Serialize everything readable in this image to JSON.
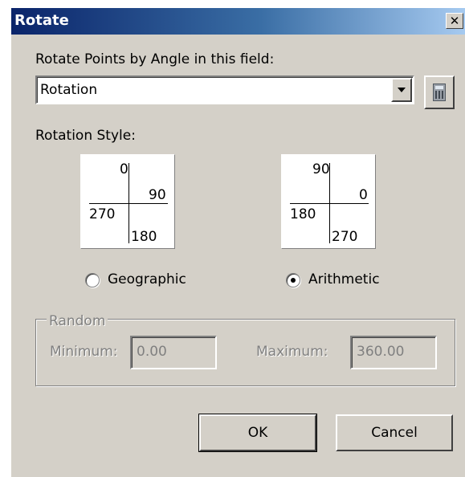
{
  "window": {
    "title": "Rotate",
    "close_icon": "close-icon"
  },
  "rotate_field": {
    "label": "Rotate Points by Angle in this field:",
    "selected_value": "Rotation",
    "calculator_icon": "calculator-icon"
  },
  "rotation_style": {
    "label": "Rotation Style:",
    "geographic": {
      "label": "Geographic",
      "checked": false,
      "top": "0",
      "right": "90",
      "left": "270",
      "bottom": "180"
    },
    "arithmetic": {
      "label": "Arithmetic",
      "checked": true,
      "top": "90",
      "right": "0",
      "left": "180",
      "bottom": "270"
    }
  },
  "random": {
    "label": "Random",
    "minimum_label": "Minimum:",
    "minimum_value": "0.00",
    "maximum_label": "Maximum:",
    "maximum_value": "360.00"
  },
  "buttons": {
    "ok": "OK",
    "cancel": "Cancel"
  }
}
